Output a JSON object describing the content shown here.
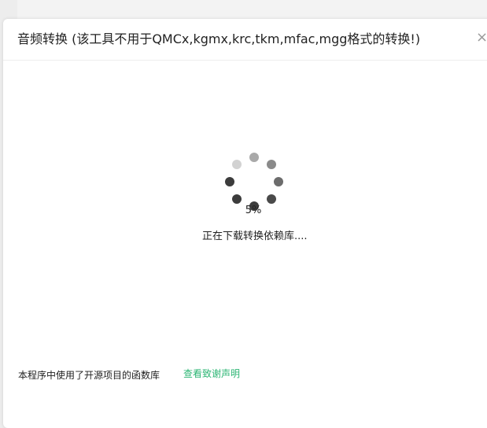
{
  "dialog": {
    "title": "音频转换 (该工具不用于QMCx,kgmx,krc,tkm,mfac,mgg格式的转换!)",
    "close_glyph": "×"
  },
  "progress": {
    "percent_text": "5%",
    "percent": 5,
    "status_text": "正在下载转换依赖库...."
  },
  "footer": {
    "notice": "本程序中使用了开源项目的函数库",
    "link_label": "查看致谢声明"
  },
  "colors": {
    "accent_link": "#2bb573",
    "spinner_dark": "#3c3c3c",
    "spinner_mid": "#6e6e6e",
    "spinner_light": "#cfcfcf"
  },
  "icons": {
    "loading": "loading-spinner-icon",
    "close": "close-icon"
  }
}
